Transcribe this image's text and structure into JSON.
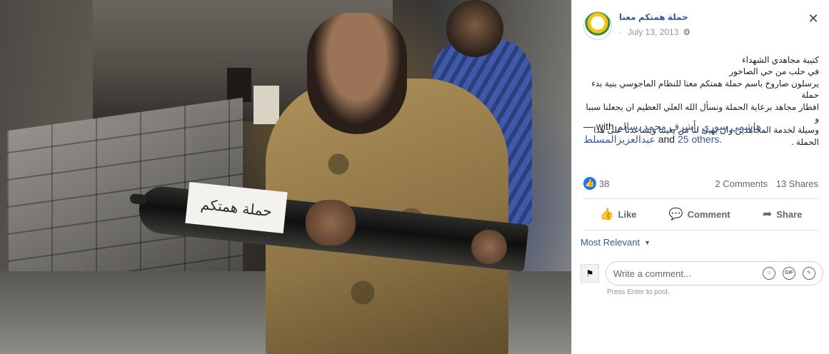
{
  "post": {
    "page_name": "حملة همتكم معنا",
    "date": "July 13, 2013",
    "separator": "·",
    "text_lines": [
      "كتيبة مجاهدي الشهداء",
      "في حلب من حي الصاخور",
      "يرسلون صاروخ باسم حملة همتكم معنا للنظام الماجوسي بنية بدء حملة",
      "افطار مجاهد برعاية الحملة ونسأل الله العلي العظيم ان يجعلنا سببا و",
      "وسيلة لخدمة المجاهدين وان يهيئ لنا من يعيننا ويساعدنا على هذا الحملة ."
    ],
    "with_prefix": "— with",
    "tagged": "هاشمي سوري ,أشرف محمد ,سالم عبدالعزيزالمسلط",
    "and_word": "and",
    "others_link": "25 others."
  },
  "stats": {
    "likes": "38",
    "comments": "2 Comments",
    "shares": "13 Shares"
  },
  "actions": {
    "like": "Like",
    "comment": "Comment",
    "share": "Share"
  },
  "comments": {
    "sort_label": "Most Relevant",
    "input_placeholder": "Write a comment...",
    "hint": "Press Enter to post."
  },
  "photo": {
    "rocket_label": "حملة همتكم"
  },
  "icons": {
    "close": "close-icon",
    "settings": "gear-icon",
    "like": "thumbs-up-icon",
    "comment": "speech-bubble-icon",
    "share": "share-arrow-icon",
    "emoji": "smiley-icon",
    "gif": "gif-icon",
    "sticker": "sticker-icon"
  },
  "colors": {
    "link": "#385898",
    "like_blue": "#1877f2",
    "muted": "#606770"
  }
}
